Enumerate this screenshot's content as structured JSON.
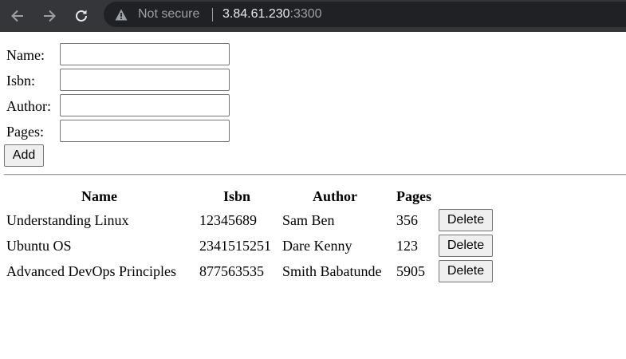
{
  "browser": {
    "security_label": "Not secure",
    "url_host": "3.84.61.230",
    "url_port": ":3300"
  },
  "form": {
    "name_label": "Name:",
    "isbn_label": "Isbn:",
    "author_label": "Author:",
    "pages_label": "Pages:",
    "name_value": "",
    "isbn_value": "",
    "author_value": "",
    "pages_value": "",
    "add_label": "Add"
  },
  "table": {
    "headers": [
      "Name",
      "Isbn",
      "Author",
      "Pages"
    ],
    "rows": [
      {
        "name": "Understanding Linux",
        "isbn": "12345689",
        "author": "Sam Ben",
        "pages": "356",
        "action": "Delete"
      },
      {
        "name": "Ubuntu OS",
        "isbn": "2341515251",
        "author": "Dare Kenny",
        "pages": "123",
        "action": "Delete"
      },
      {
        "name": "Advanced DevOps Principles",
        "isbn": "877563535",
        "author": "Smith Babatunde",
        "pages": "5905",
        "action": "Delete"
      }
    ]
  }
}
